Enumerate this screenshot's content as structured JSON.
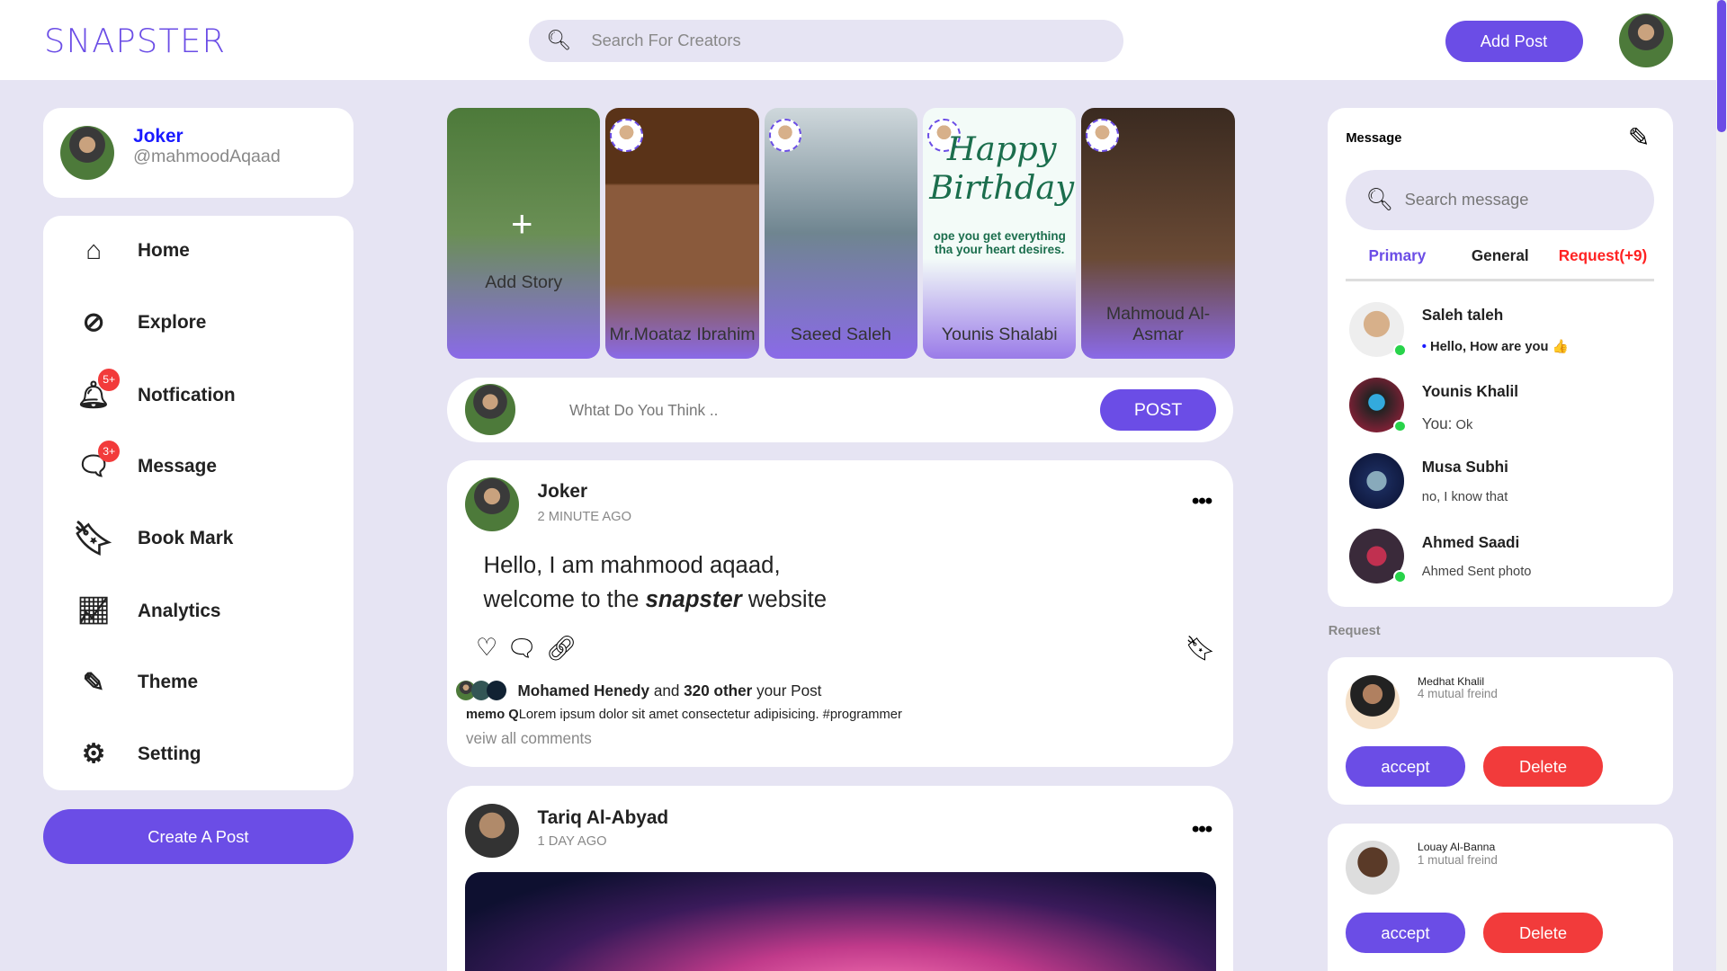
{
  "header": {
    "logo": "SNAPSTER",
    "search_placeholder": "Search For Creators",
    "add_post": "Add Post"
  },
  "profile": {
    "name": "Joker",
    "handle": "@mahmoodAqaad"
  },
  "nav": [
    {
      "label": "Home",
      "icon": "home-icon"
    },
    {
      "label": "Explore",
      "icon": "compass-icon"
    },
    {
      "label": "Notfication",
      "icon": "bell-icon",
      "badge": "5+"
    },
    {
      "label": "Message",
      "icon": "chat-icon",
      "badge": "3+"
    },
    {
      "label": "Book Mark",
      "icon": "bookmark-icon"
    },
    {
      "label": "Analytics",
      "icon": "chart-icon"
    },
    {
      "label": "Theme",
      "icon": "brush-icon"
    },
    {
      "label": "Setting",
      "icon": "gear-icon"
    }
  ],
  "create_post": "Create A Post",
  "stories": [
    {
      "name": "Add Story"
    },
    {
      "name": "Mr.Moataz Ibrahim"
    },
    {
      "name": "Saeed Saleh"
    },
    {
      "name": "Younis Shalabi",
      "image_text": "Happy Birthday",
      "image_sub": "ope you get everything tha your heart desires."
    },
    {
      "name": "Mahmoud Al-Asmar"
    }
  ],
  "composer": {
    "placeholder": "Whtat Do You Think ..",
    "button": "POST"
  },
  "posts": [
    {
      "author": "Joker",
      "time": "2 MINUTE AGO",
      "line1": "Hello, I am mahmood aqaad,",
      "line2_pre": "welcome to the ",
      "line2_em": "snapster",
      "line2_post": " website",
      "likes_name": "Mohamed Henedy",
      "likes_and": "and",
      "likes_count": "320 other",
      "likes_suffix": "your Post",
      "caption_user": "memo Q",
      "caption": "Lorem ipsum dolor sit amet consectetur adipisicing. #programmer",
      "view_comments": "veiw all comments"
    },
    {
      "author": "Tariq Al-Abyad",
      "time": "1 DAY AGO"
    }
  ],
  "messages": {
    "title": "Message",
    "search_placeholder": "Search message",
    "tabs": [
      "Primary",
      "General",
      "Request(+9)"
    ],
    "items": [
      {
        "name": "Saleh taleh",
        "text": "Hello, How are you 👍",
        "online": true
      },
      {
        "name": "Younis Khalil",
        "text_prefix": "You:",
        "text": "Ok",
        "online": true
      },
      {
        "name": "Musa Subhi",
        "text": "no, I know that",
        "online": false
      },
      {
        "name": "Ahmed Saadi",
        "text": "Ahmed Sent photo",
        "online": true
      }
    ]
  },
  "requests": {
    "title": "Request",
    "items": [
      {
        "name": "Medhat Khalil",
        "mutual": "4 mutual freind",
        "accept": "accept",
        "delete": "Delete"
      },
      {
        "name": "Louay Al-Banna",
        "mutual": "1 mutual freind",
        "accept": "accept",
        "delete": "Delete"
      }
    ]
  },
  "colors": {
    "accent": "#6b4de6",
    "danger": "#f23b3b",
    "background": "#e6e4f3",
    "online": "#28d34a"
  }
}
